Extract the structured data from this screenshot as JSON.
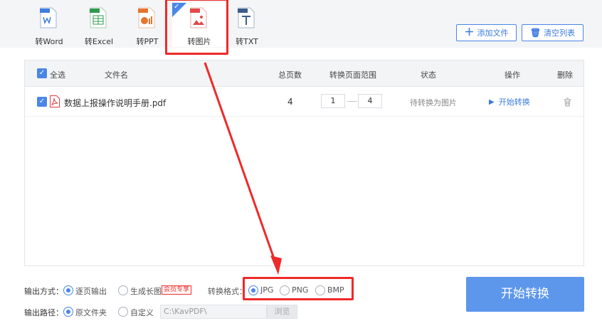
{
  "toolbar": {
    "tools": [
      {
        "label": "转Word",
        "badge": "WDX",
        "color": "#3d7fe0"
      },
      {
        "label": "转Excel",
        "badge": "XLSX",
        "color": "#2f9b4e"
      },
      {
        "label": "转PPT",
        "badge": "PPTX",
        "color": "#e7742f"
      },
      {
        "label": "转图片",
        "badge": "JPG",
        "color": "#e24a4a"
      },
      {
        "label": "转TXT",
        "badge": "TXT",
        "color": "#3b5c8d"
      }
    ],
    "add_file": "添加文件",
    "clear_list": "清空列表"
  },
  "table": {
    "headers": {
      "select_all": "全选",
      "filename": "文件名",
      "pages": "总页数",
      "range": "转换页面范围",
      "status": "状态",
      "action": "操作",
      "delete": "删除"
    },
    "rows": [
      {
        "filename": "数据上报操作说明手册.pdf",
        "pages": "4",
        "range_from": "1",
        "range_to": "4",
        "status": "待转换为图片",
        "action": "开始转换"
      }
    ]
  },
  "options": {
    "output_mode_label": "输出方式：",
    "output_mode_1": "逐页输出",
    "output_mode_2": "生成长图",
    "vip_badge": "会员专享",
    "format_label": "转换格式：",
    "format_jpg": "JPG",
    "format_png": "PNG",
    "format_bmp": "BMP",
    "output_path_label": "输出路径：",
    "path_original": "原文件夹",
    "path_custom": "自定义",
    "path_value": "C:\\KavPDF\\",
    "browse": "浏览"
  },
  "start_button": "开始转换",
  "colors": {
    "accent": "#4a86e8",
    "highlight": "#ee2a2a",
    "start_button": "#5d97ec"
  }
}
